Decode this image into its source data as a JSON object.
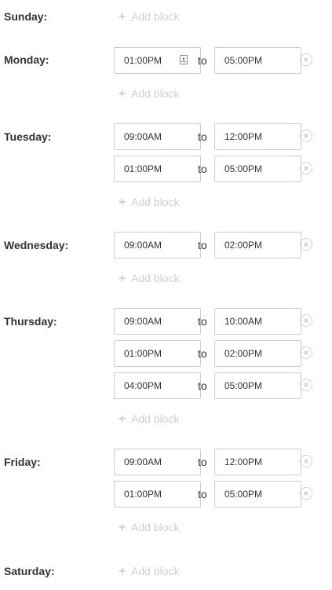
{
  "labels": {
    "add_block": "Add block",
    "to": "to"
  },
  "days": {
    "sunday": {
      "label": "Sunday:"
    },
    "monday": {
      "label": "Monday:",
      "blocks": [
        {
          "start": "01:00PM",
          "end": "05:00PM"
        }
      ]
    },
    "tuesday": {
      "label": "Tuesday:",
      "blocks": [
        {
          "start": "09:00AM",
          "end": "12:00PM"
        },
        {
          "start": "01:00PM",
          "end": "05:00PM"
        }
      ]
    },
    "wednesday": {
      "label": "Wednesday:",
      "blocks": [
        {
          "start": "09:00AM",
          "end": "02:00PM"
        }
      ]
    },
    "thursday": {
      "label": "Thursday:",
      "blocks": [
        {
          "start": "09:00AM",
          "end": "10:00AM"
        },
        {
          "start": "01:00PM",
          "end": "02:00PM"
        },
        {
          "start": "04:00PM",
          "end": "05:00PM"
        }
      ]
    },
    "friday": {
      "label": "Friday:",
      "blocks": [
        {
          "start": "09:00AM",
          "end": "12:00PM"
        },
        {
          "start": "01:00PM",
          "end": "05:00PM"
        }
      ]
    },
    "saturday": {
      "label": "Saturday:"
    }
  },
  "icons": {
    "add": "plus-icon",
    "remove": "remove-circle-icon",
    "picker": "calendar-icon"
  }
}
